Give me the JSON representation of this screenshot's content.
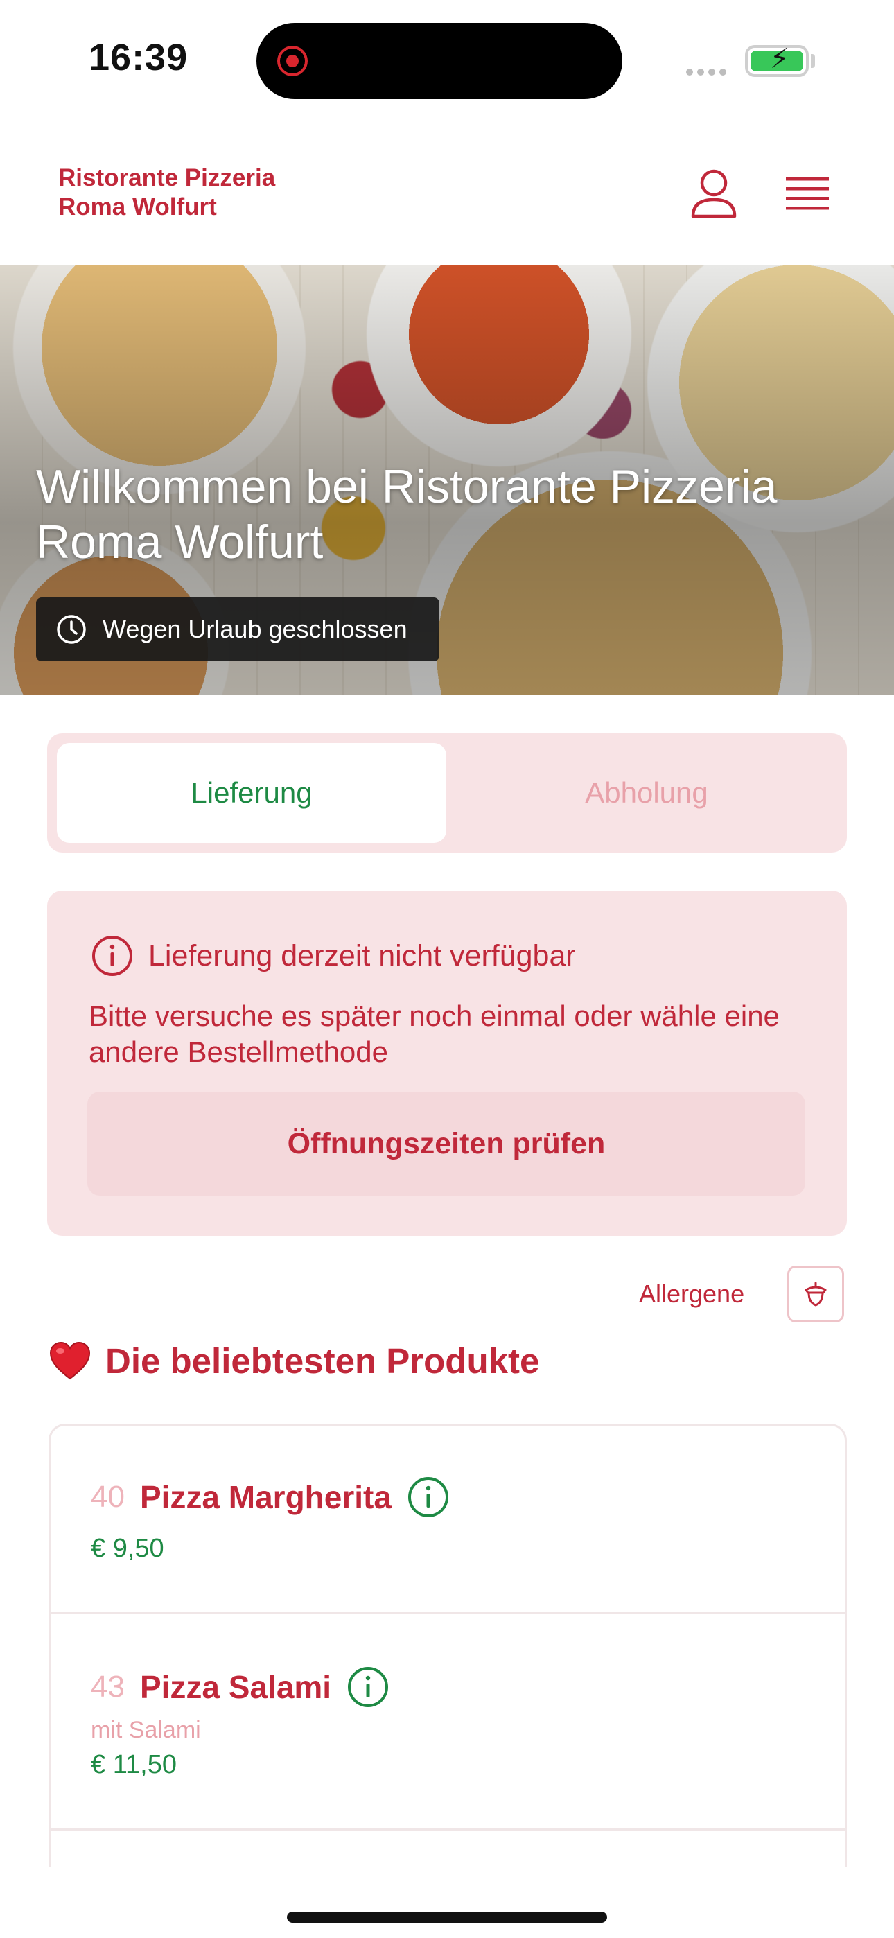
{
  "status_bar": {
    "time": "16:39"
  },
  "header": {
    "brand": "Ristorante Pizzeria\nRoma Wolfurt"
  },
  "hero": {
    "title": "Willkommen bei Ristorante Pizzeria Roma Wolfurt",
    "status_badge": "Wegen Urlaub geschlossen"
  },
  "order_toggle": {
    "options": [
      "Lieferung",
      "Abholung"
    ],
    "selected": "Lieferung"
  },
  "alert": {
    "title": "Lieferung derzeit nicht verfügbar",
    "message": "Bitte versuche es später noch einmal oder wähle eine andere Bestellmethode",
    "button_label": "Öffnungszeiten prüfen"
  },
  "allergene": {
    "label": "Allergene"
  },
  "section": {
    "title": "Die beliebtesten Produkte"
  },
  "products": [
    {
      "number": "40",
      "name": "Pizza Margherita",
      "description": "",
      "price": "€ 9,50"
    },
    {
      "number": "43",
      "name": "Pizza Salami",
      "description": "mit Salami",
      "price": "€ 11,50"
    }
  ],
  "colors": {
    "brand_red": "#c0283a",
    "green": "#1e8a44",
    "pink_bg": "#f8e3e5",
    "muted_pink": "#e8a1a9"
  }
}
